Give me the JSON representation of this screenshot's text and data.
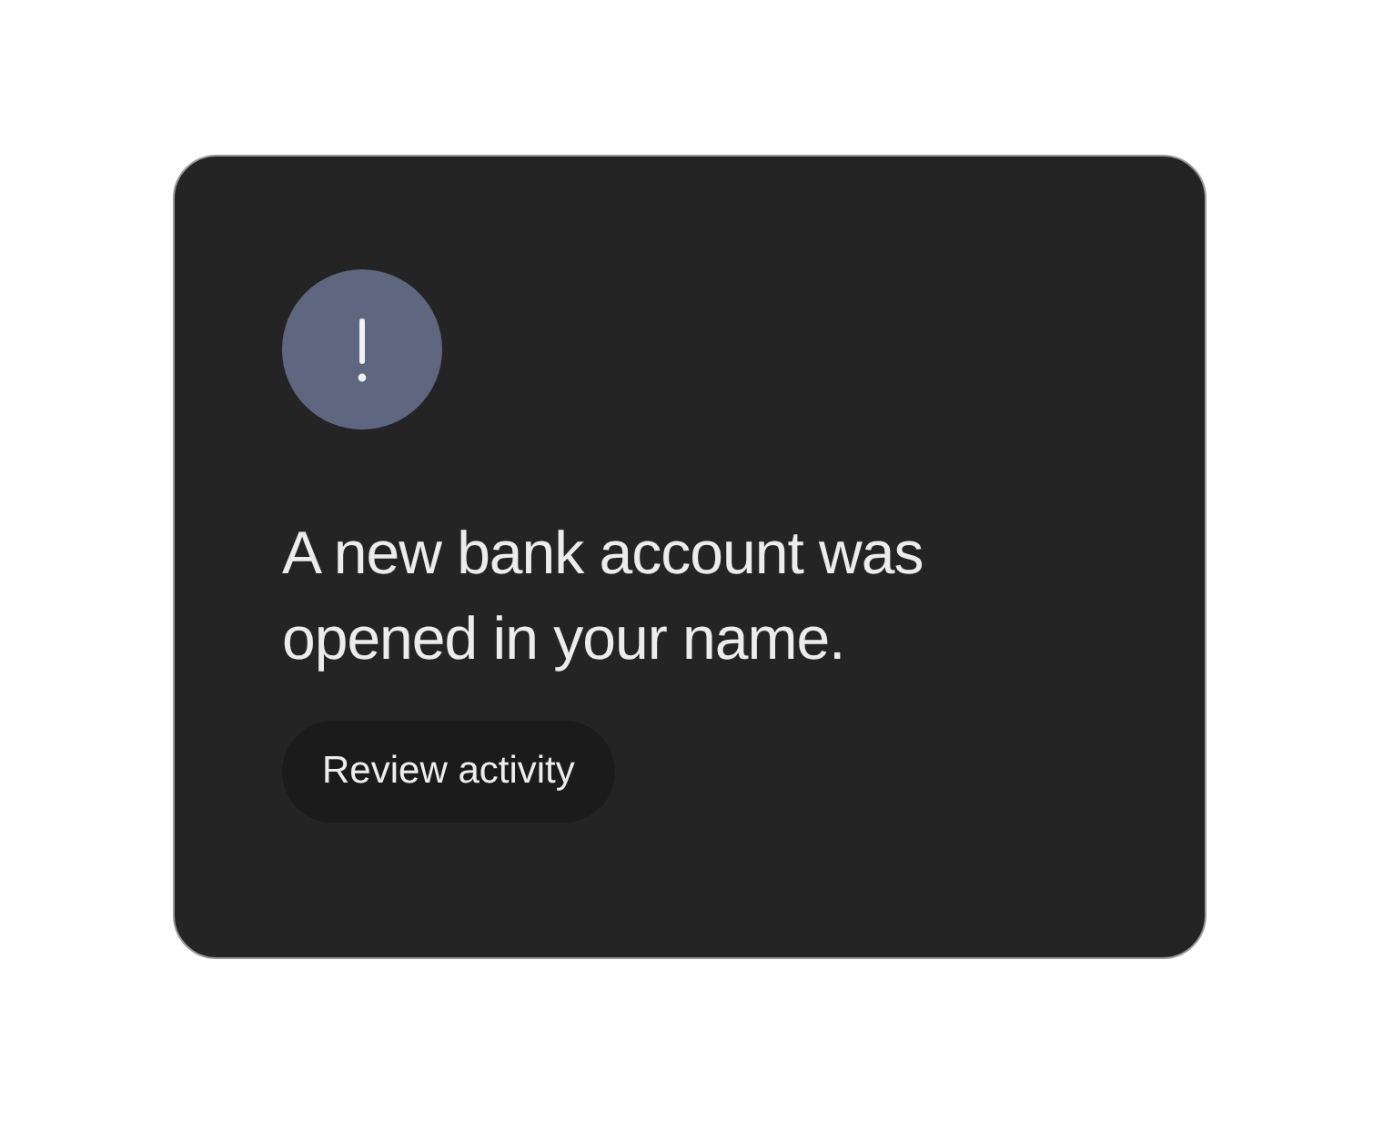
{
  "alert": {
    "message": "A new bank account was opened in your name.",
    "action": "Review activity"
  }
}
